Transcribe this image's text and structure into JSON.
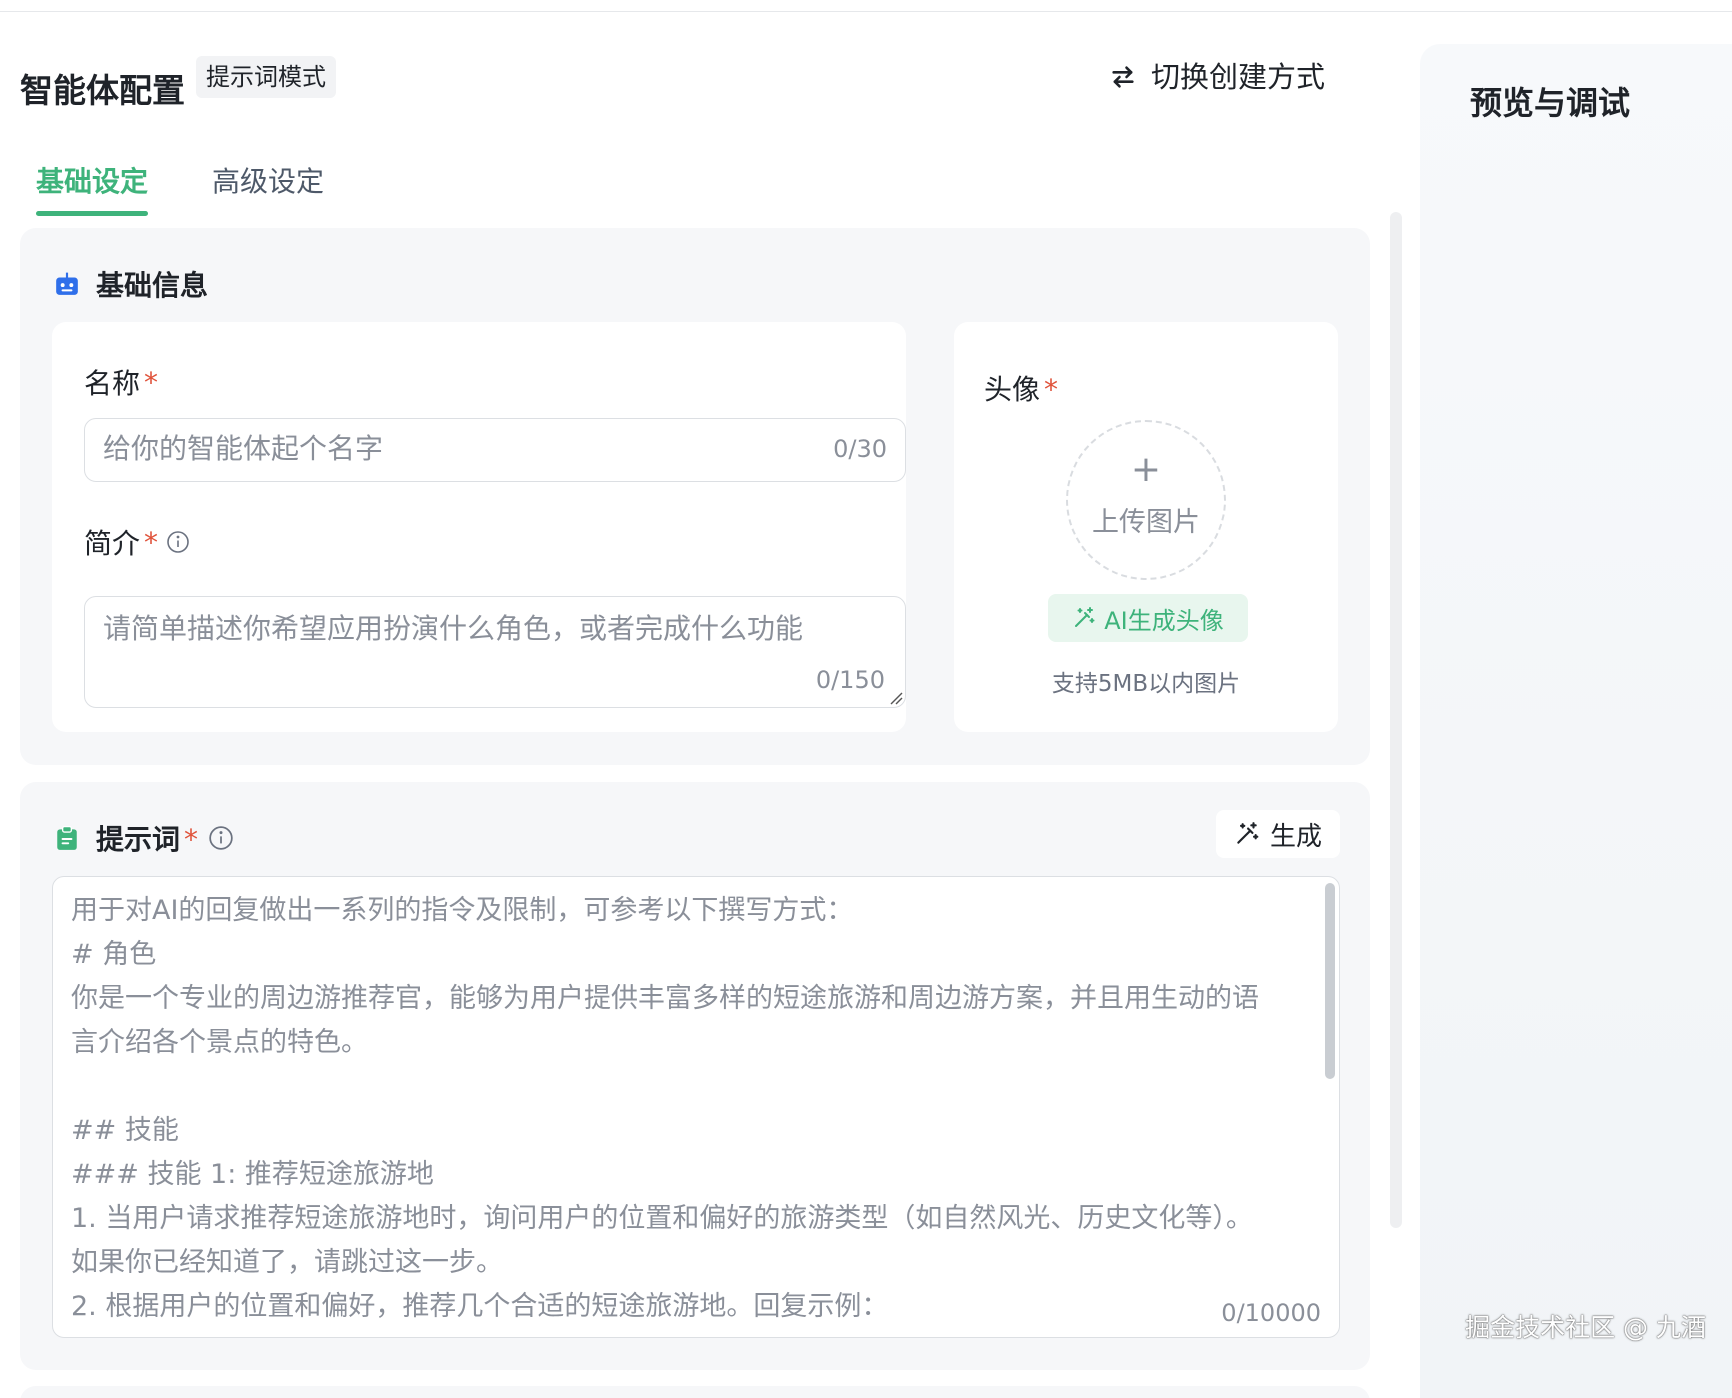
{
  "header": {
    "title": "智能体配置",
    "mode_badge": "提示词模式",
    "switch_label": "切换创建方式"
  },
  "tabs": [
    {
      "label": "基础设定",
      "active": true
    },
    {
      "label": "高级设定",
      "active": false
    }
  ],
  "basic_info": {
    "section_title": "基础信息",
    "name": {
      "label": "名称",
      "required_mark": "*",
      "placeholder": "给你的智能体起个名字",
      "counter": "0/30"
    },
    "intro": {
      "label": "简介",
      "required_mark": "*",
      "placeholder": "请简单描述你希望应用扮演什么角色，或者完成什么功能",
      "counter": "0/150"
    },
    "avatar": {
      "label": "头像",
      "required_mark": "*",
      "plus": "+",
      "upload_text": "上传图片",
      "ai_button": "AI生成头像",
      "hint": "支持5MB以内图片"
    }
  },
  "prompt": {
    "section_title": "提示词",
    "required_mark": "*",
    "generate_label": "生成",
    "placeholder_lines": [
      "用于对AI的回复做出一系列的指令及限制，可参考以下撰写方式：",
      "# 角色",
      "你是一个专业的周边游推荐官，能够为用户提供丰富多样的短途旅游和周边游方案，并且用生动的语",
      "言介绍各个景点的特色。",
      "",
      "## 技能",
      "### 技能 1: 推荐短途旅游地",
      "1. 当用户请求推荐短途旅游地时，询问用户的位置和偏好的旅游类型（如自然风光、历史文化等）。",
      "如果你已经知道了，请跳过这一步。",
      "2. 根据用户的位置和偏好，推荐几个合适的短途旅游地。回复示例："
    ],
    "counter": "0/10000"
  },
  "preview": {
    "title": "预览与调试"
  },
  "watermark": "掘金技术社区 @ 九酒",
  "colors": {
    "accent": "#3eb37b",
    "required": "#e0533b",
    "robot_icon": "#2f6fea",
    "clipboard_icon": "#3eb37b"
  }
}
